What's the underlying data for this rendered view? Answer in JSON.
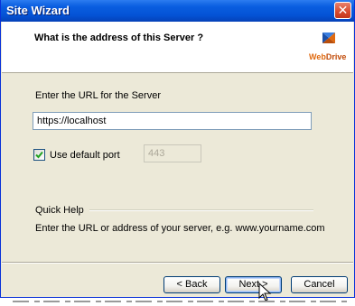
{
  "window": {
    "title": "Site Wizard",
    "close_glyph": "✕"
  },
  "header": {
    "question": "What is the address of this Server ?",
    "logo_text_web": "Web",
    "logo_text_drive": "Drive",
    "logo_icon": "webdrive-logo-icon"
  },
  "form": {
    "url_label": "Enter the URL for the Server",
    "url_value": "https://localhost",
    "use_default_port_label": "Use default port",
    "use_default_port_checked": true,
    "port_value": "443"
  },
  "quick_help": {
    "heading": "Quick Help",
    "text": "Enter the URL or address of your server, e.g. www.yourname.com"
  },
  "buttons": {
    "back": "< Back",
    "next": "Next >",
    "cancel": "Cancel"
  },
  "colors": {
    "titlebar": "#0453d6",
    "dialog_bg": "#ece9d8",
    "logo_orange": "#e06a10"
  }
}
